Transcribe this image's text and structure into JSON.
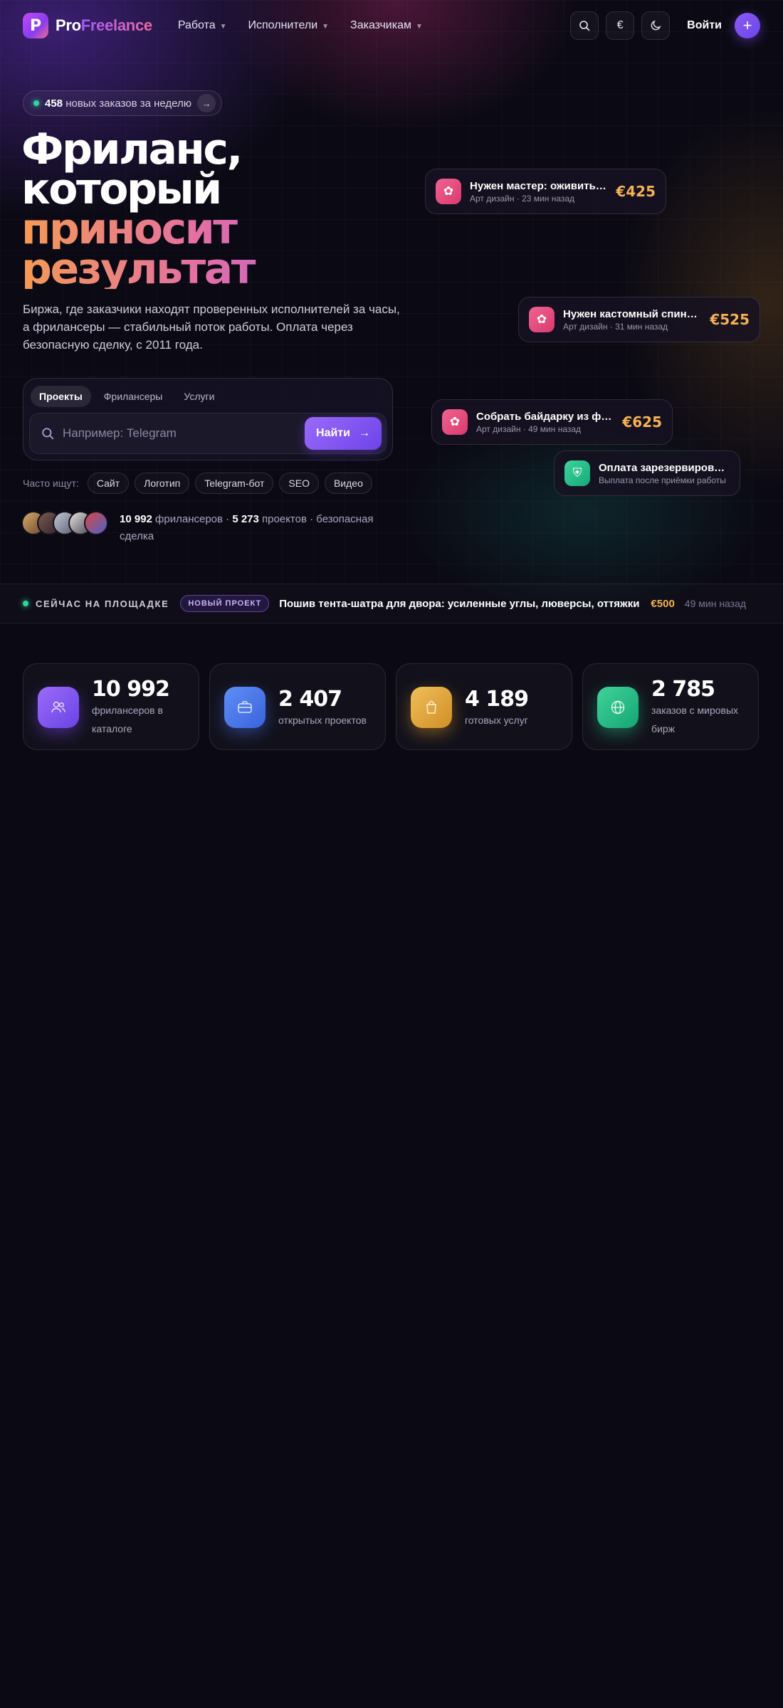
{
  "brand": {
    "logo_letter": "P",
    "name_part1": "Pro",
    "name_part2": "Freelance"
  },
  "nav": {
    "menu": [
      "Работа",
      "Исполнители",
      "Заказчикам"
    ],
    "currency": "€",
    "login": "Войти",
    "plus": "+"
  },
  "hero": {
    "badge_count": "458",
    "badge_text": "новых заказов за неделю",
    "title_line1": "Фриланс,",
    "title_line2": "который",
    "title_line3": "приносит",
    "title_line4": "результат",
    "lead": "Биржа, где заказчики находят проверенных исполнителей за часы, а фрилансеры — стабильный поток работы. Оплата через безопасную сделку, с 2011 года.",
    "tabs": [
      "Проекты",
      "Фрилансеры",
      "Услуги"
    ],
    "search_placeholder": "Например: Telegram",
    "search_button": "Найти",
    "popular_label": "Часто ищут:",
    "popular": [
      "Сайт",
      "Логотип",
      "Telegram-бот",
      "SEO",
      "Видео"
    ],
    "social_count1": "10 992",
    "social_text1": " фрилансеров · ",
    "social_count2": "5 273",
    "social_text2": " проектов · безопасная сделка"
  },
  "floating_cards": [
    {
      "title": "Нужен мастер: оживить с...",
      "meta": "Арт дизайн · 23 мин назад",
      "price": "€425"
    },
    {
      "title": "Нужен кастомный спинни...",
      "meta": "Арт дизайн · 31 мин назад",
      "price": "€525"
    },
    {
      "title": "Собрать байдарку из фан...",
      "meta": "Арт дизайн · 49 мин назад",
      "price": "€625"
    },
    {
      "title": "Оплата зарезервирована",
      "meta": "Выплата после приёмки работы"
    }
  ],
  "live": {
    "label": "СЕЙЧАС НА ПЛОЩАДКЕ",
    "badge": "НОВЫЙ ПРОЕКТ",
    "title": "Пошив тента-шатра для двора: усиленные углы, люверсы, оттяжки",
    "price": "€500",
    "time": "49 мин назад"
  },
  "stats": [
    {
      "value": "10 992",
      "label": "фрилансеров в каталоге",
      "icon": "users-icon"
    },
    {
      "value": "2 407",
      "label": "открытых проектов",
      "icon": "briefcase-icon"
    },
    {
      "value": "4 189",
      "label": "готовых услуг",
      "icon": "bag-icon"
    },
    {
      "value": "2 785",
      "label": "заказов с мировых бирж",
      "icon": "globe-icon"
    }
  ],
  "colors": {
    "accent": "#7c48f0",
    "price": "#f4b253",
    "live_dot": "#34d399"
  }
}
